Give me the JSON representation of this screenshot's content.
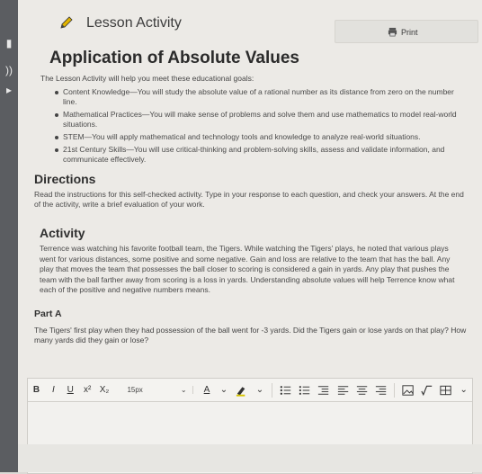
{
  "header": {
    "title": "Lesson Activity",
    "print_label": "Print"
  },
  "main": {
    "title": "Application of Absolute Values",
    "intro": "The Lesson Activity will help you meet these educational goals:",
    "goals": [
      "Content Knowledge—You will study the absolute value of a rational number as its distance from zero on the number line.",
      "Mathematical Practices—You will make sense of problems and solve them and use mathematics to model real-world situations.",
      "STEM—You will apply mathematical and technology tools and knowledge to analyze real-world situations.",
      "21st Century Skills—You will use critical-thinking and problem-solving skills, assess and validate information, and communicate effectively."
    ],
    "directions_title": "Directions",
    "directions_text": "Read the instructions for this self-checked activity. Type in your response to each question, and check your answers. At the end of the activity, write a brief evaluation of your work.",
    "activity_title": "Activity",
    "activity_text": "Terrence was watching his favorite football team, the Tigers. While watching the Tigers' plays, he noted that various plays went for various distances, some positive and some negative. Gain and loss are relative to the team that has the ball. Any play that moves the team that possesses the ball closer to scoring is considered a gain in yards. Any play that pushes the team with the ball farther away from scoring is a loss in yards. Understanding absolute values will help Terrence know what each of the positive and negative numbers means.",
    "part_title": "Part A",
    "question": "The Tigers' first play when they had possession of the ball went for -3 yards. Did the Tigers gain or lose yards on that play? How many yards did they gain or lose?"
  },
  "editor": {
    "bold": "B",
    "italic": "I",
    "underline": "U",
    "superscript": "x²",
    "subscript": "X₂",
    "font_size": "15px",
    "font_color": "A"
  },
  "colors": {
    "page": "#eceae6",
    "rail": "#5b5d61",
    "text": "#2f2f2f"
  }
}
